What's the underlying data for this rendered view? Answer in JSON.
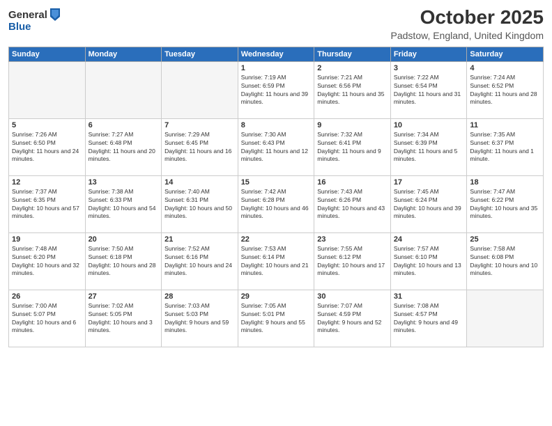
{
  "header": {
    "logo": {
      "line1": "General",
      "line2": "Blue"
    },
    "month": "October 2025",
    "location": "Padstow, England, United Kingdom"
  },
  "weekdays": [
    "Sunday",
    "Monday",
    "Tuesday",
    "Wednesday",
    "Thursday",
    "Friday",
    "Saturday"
  ],
  "weeks": [
    [
      {
        "day": "",
        "info": ""
      },
      {
        "day": "",
        "info": ""
      },
      {
        "day": "",
        "info": ""
      },
      {
        "day": "1",
        "sunrise": "7:19 AM",
        "sunset": "6:59 PM",
        "daylight": "11 hours and 39 minutes."
      },
      {
        "day": "2",
        "sunrise": "7:21 AM",
        "sunset": "6:56 PM",
        "daylight": "11 hours and 35 minutes."
      },
      {
        "day": "3",
        "sunrise": "7:22 AM",
        "sunset": "6:54 PM",
        "daylight": "11 hours and 31 minutes."
      },
      {
        "day": "4",
        "sunrise": "7:24 AM",
        "sunset": "6:52 PM",
        "daylight": "11 hours and 28 minutes."
      }
    ],
    [
      {
        "day": "5",
        "sunrise": "7:26 AM",
        "sunset": "6:50 PM",
        "daylight": "11 hours and 24 minutes."
      },
      {
        "day": "6",
        "sunrise": "7:27 AM",
        "sunset": "6:48 PM",
        "daylight": "11 hours and 20 minutes."
      },
      {
        "day": "7",
        "sunrise": "7:29 AM",
        "sunset": "6:45 PM",
        "daylight": "11 hours and 16 minutes."
      },
      {
        "day": "8",
        "sunrise": "7:30 AM",
        "sunset": "6:43 PM",
        "daylight": "11 hours and 12 minutes."
      },
      {
        "day": "9",
        "sunrise": "7:32 AM",
        "sunset": "6:41 PM",
        "daylight": "11 hours and 9 minutes."
      },
      {
        "day": "10",
        "sunrise": "7:34 AM",
        "sunset": "6:39 PM",
        "daylight": "11 hours and 5 minutes."
      },
      {
        "day": "11",
        "sunrise": "7:35 AM",
        "sunset": "6:37 PM",
        "daylight": "11 hours and 1 minute."
      }
    ],
    [
      {
        "day": "12",
        "sunrise": "7:37 AM",
        "sunset": "6:35 PM",
        "daylight": "10 hours and 57 minutes."
      },
      {
        "day": "13",
        "sunrise": "7:38 AM",
        "sunset": "6:33 PM",
        "daylight": "10 hours and 54 minutes."
      },
      {
        "day": "14",
        "sunrise": "7:40 AM",
        "sunset": "6:31 PM",
        "daylight": "10 hours and 50 minutes."
      },
      {
        "day": "15",
        "sunrise": "7:42 AM",
        "sunset": "6:28 PM",
        "daylight": "10 hours and 46 minutes."
      },
      {
        "day": "16",
        "sunrise": "7:43 AM",
        "sunset": "6:26 PM",
        "daylight": "10 hours and 43 minutes."
      },
      {
        "day": "17",
        "sunrise": "7:45 AM",
        "sunset": "6:24 PM",
        "daylight": "10 hours and 39 minutes."
      },
      {
        "day": "18",
        "sunrise": "7:47 AM",
        "sunset": "6:22 PM",
        "daylight": "10 hours and 35 minutes."
      }
    ],
    [
      {
        "day": "19",
        "sunrise": "7:48 AM",
        "sunset": "6:20 PM",
        "daylight": "10 hours and 32 minutes."
      },
      {
        "day": "20",
        "sunrise": "7:50 AM",
        "sunset": "6:18 PM",
        "daylight": "10 hours and 28 minutes."
      },
      {
        "day": "21",
        "sunrise": "7:52 AM",
        "sunset": "6:16 PM",
        "daylight": "10 hours and 24 minutes."
      },
      {
        "day": "22",
        "sunrise": "7:53 AM",
        "sunset": "6:14 PM",
        "daylight": "10 hours and 21 minutes."
      },
      {
        "day": "23",
        "sunrise": "7:55 AM",
        "sunset": "6:12 PM",
        "daylight": "10 hours and 17 minutes."
      },
      {
        "day": "24",
        "sunrise": "7:57 AM",
        "sunset": "6:10 PM",
        "daylight": "10 hours and 13 minutes."
      },
      {
        "day": "25",
        "sunrise": "7:58 AM",
        "sunset": "6:08 PM",
        "daylight": "10 hours and 10 minutes."
      }
    ],
    [
      {
        "day": "26",
        "sunrise": "7:00 AM",
        "sunset": "5:07 PM",
        "daylight": "10 hours and 6 minutes."
      },
      {
        "day": "27",
        "sunrise": "7:02 AM",
        "sunset": "5:05 PM",
        "daylight": "10 hours and 3 minutes."
      },
      {
        "day": "28",
        "sunrise": "7:03 AM",
        "sunset": "5:03 PM",
        "daylight": "9 hours and 59 minutes."
      },
      {
        "day": "29",
        "sunrise": "7:05 AM",
        "sunset": "5:01 PM",
        "daylight": "9 hours and 55 minutes."
      },
      {
        "day": "30",
        "sunrise": "7:07 AM",
        "sunset": "4:59 PM",
        "daylight": "9 hours and 52 minutes."
      },
      {
        "day": "31",
        "sunrise": "7:08 AM",
        "sunset": "4:57 PM",
        "daylight": "9 hours and 49 minutes."
      },
      {
        "day": "",
        "info": ""
      }
    ]
  ]
}
